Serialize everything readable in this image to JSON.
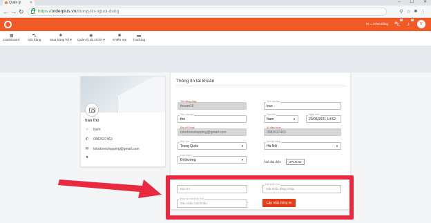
{
  "browser": {
    "tab_title": "Quản lý",
    "url_protocol": "https://",
    "url_host": "orderplus.vn",
    "url_path": "/thong-tin-nguoi-dung"
  },
  "header": {
    "rate": "¥1 = 3750 Đồng",
    "cart_badge": "0",
    "notif_badge": "0",
    "avatar_initials": "tr"
  },
  "nav": {
    "items": [
      {
        "label": "Dashboard",
        "icon": "dashboard-icon"
      },
      {
        "label": "Giỏ hàng",
        "icon": "cart-icon"
      },
      {
        "label": "Mua hàng hộ ▾",
        "icon": "purchase-icon"
      },
      {
        "label": "Quản lý tài chính ▾",
        "icon": "finance-icon"
      },
      {
        "label": "Khiếu nại",
        "icon": "complaint-icon"
      },
      {
        "label": "Tracking",
        "icon": "truck-icon"
      }
    ]
  },
  "profile": {
    "name": "tran tho",
    "gender": "Nam",
    "phone": "0982637463",
    "email": "totodoreshopping@gmail.com"
  },
  "form": {
    "title": "Thông tin tài khoản",
    "username_label": "Tên đăng nhập",
    "username": "thoam16",
    "lastname_label": "Tên của bạn",
    "lastname": "tran",
    "firstname_label": "Tên của bạn",
    "firstname": "tho",
    "gender_label": "Giới tính",
    "gender": "Nam",
    "birthday_label": "Ngày sinh",
    "birthday": "20/05/2021 14:52",
    "email_label": "Địa chỉ Email",
    "email": "totodoreshopping@gmail.com",
    "phone_label": "Số điện thoại",
    "phone": "0982637463",
    "country_label": "Khu Vực",
    "country": "Trung Quốc",
    "city_label": "Nơi lấy hàng",
    "city": "Hà Nội",
    "tier_label": "Loại khách",
    "tier": "Đi thường",
    "avatar_label": "Ảnh đại diện",
    "upload_label": "UPLOAD"
  },
  "password": {
    "address_placeholder": "Địa chỉ",
    "newpass_label": "Mật khẩu mới",
    "newpass_placeholder": "Mật khẩu đăng nhập",
    "confirm_label": "Nhập lại mật khẩu mới",
    "confirm_placeholder": "Xác nhận mật khẩu",
    "save_label": "Cập nhật thông tin"
  },
  "colors": {
    "brand": "#f15a24",
    "highlight": "#e8293f"
  }
}
